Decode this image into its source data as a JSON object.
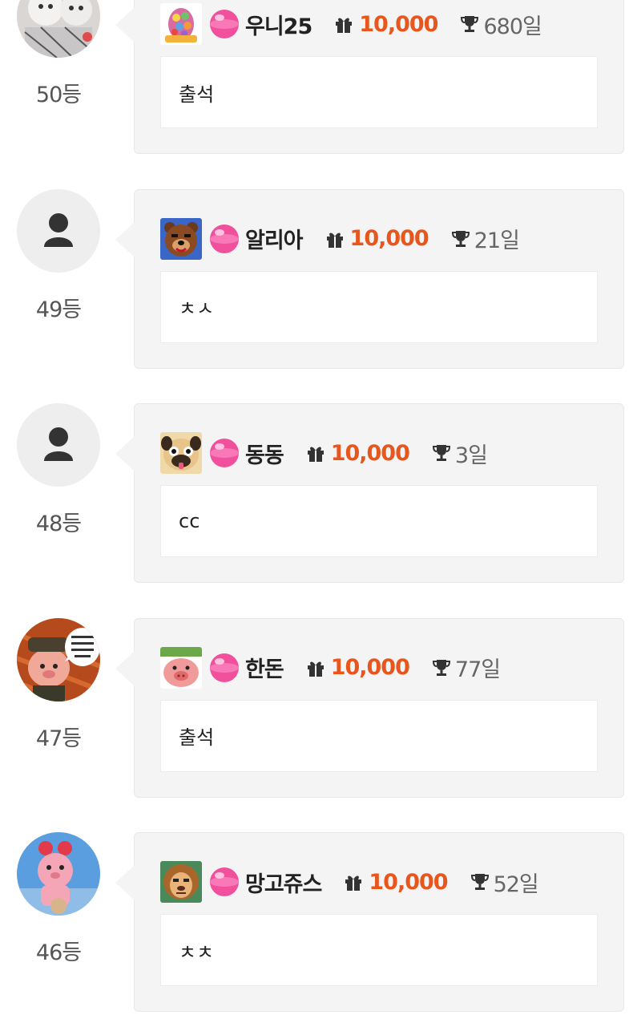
{
  "entries": [
    {
      "rank": "50등",
      "nickname": "우니25",
      "points": "10,000",
      "days": "680일",
      "comment": "출석",
      "avatar": "photo-dogs",
      "badge": "candy-badge",
      "gem_icon": "pink-gem-icon"
    },
    {
      "rank": "49등",
      "nickname": "알리아",
      "points": "10,000",
      "days": "21일",
      "comment": "ㅊㅅ",
      "avatar": "default-person",
      "badge": "bear-badge",
      "gem_icon": "pink-gem-icon"
    },
    {
      "rank": "48등",
      "nickname": "동동",
      "points": "10,000",
      "days": "3일",
      "comment": "cc",
      "avatar": "default-person",
      "badge": "pug-badge",
      "gem_icon": "pink-gem-icon"
    },
    {
      "rank": "47등",
      "nickname": "한돈",
      "points": "10,000",
      "days": "77일",
      "comment": "출석",
      "avatar": "photo-pig-speech",
      "badge": "pig-badge",
      "gem_icon": "pink-gem-icon"
    },
    {
      "rank": "46등",
      "nickname": "망고쥬스",
      "points": "10,000",
      "days": "52일",
      "comment": "ㅊㅊ",
      "avatar": "photo-pink-doll",
      "badge": "lion-badge",
      "gem_icon": "pink-gem-icon"
    }
  ],
  "colors": {
    "points": "#e8561e",
    "bubble": "#f4f4f4",
    "nickname": "#222222",
    "rank": "#555555"
  }
}
